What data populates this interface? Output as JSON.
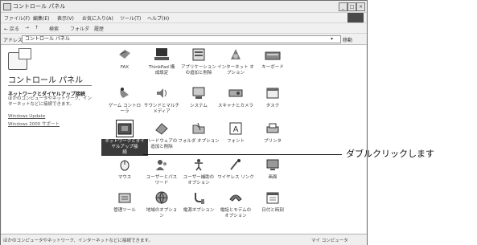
{
  "window": {
    "title": "コントロール パネル",
    "buttons": [
      "_",
      "□",
      "×"
    ]
  },
  "menubar": {
    "items": [
      "ファイル(F)",
      "編集(E)",
      "表示(V)",
      "お気に入り(A)",
      "ツール(T)",
      "ヘルプ(H)"
    ]
  },
  "toolbar": {
    "back": "← 戻る",
    "forward": "→",
    "up": "↑",
    "search": "検索",
    "folders": "フォルダ",
    "history": "履歴"
  },
  "address": {
    "label": "アドレス(D)",
    "value": "コントロール パネル",
    "go": "移動"
  },
  "left_pane": {
    "title": "コントロール パネル",
    "heading": "ネットワークとダイヤルアップ接続",
    "description": "ほかのコンピュータやネットワーク、インターネットなどに接続できます。",
    "links": [
      "Windows Update",
      "Windows 2000 サポート"
    ]
  },
  "icons": [
    {
      "name": "fax",
      "label": "FAX"
    },
    {
      "name": "thinkpad",
      "label": "ThinkPad 構\n成設定"
    },
    {
      "name": "add-remove-apps",
      "label": "アプリケーション\nの追加と削除"
    },
    {
      "name": "internet-options",
      "label": "インターネット オ\nプション"
    },
    {
      "name": "keyboard",
      "label": "キーボード"
    },
    {
      "name": "game-controller",
      "label": "ゲーム コントロ\nーラ"
    },
    {
      "name": "sounds-multimedia",
      "label": "サウンドとマルチ\nメディア"
    },
    {
      "name": "system",
      "label": "システム"
    },
    {
      "name": "scanners-cameras",
      "label": "スキャナとカメラ"
    },
    {
      "name": "tasks",
      "label": "タスク"
    },
    {
      "name": "network-dialup",
      "label": "ネットワークとダイ\nヤルアップ接\n続"
    },
    {
      "name": "add-remove-hardware",
      "label": "ハードウェアの\n追加と削除"
    },
    {
      "name": "folder-options",
      "label": "フォルダ オプション"
    },
    {
      "name": "fonts",
      "label": "フォント"
    },
    {
      "name": "printers",
      "label": "プリンタ"
    },
    {
      "name": "mouse",
      "label": "マウス"
    },
    {
      "name": "users-passwords",
      "label": "ユーザーとパス\nワード"
    },
    {
      "name": "accessibility",
      "label": "ユーザー補助の\nオプション"
    },
    {
      "name": "wireless-link",
      "label": "ワイヤレス リンク"
    },
    {
      "name": "display",
      "label": "画面"
    },
    {
      "name": "admin-tools",
      "label": "管理ツール"
    },
    {
      "name": "regional-options",
      "label": "地域のオプショ\nン"
    },
    {
      "name": "power-options",
      "label": "電源オプション"
    },
    {
      "name": "phone-modem",
      "label": "電話とモデムの\nオプション"
    },
    {
      "name": "date-time",
      "label": "日付と時刻"
    }
  ],
  "statusbar": {
    "left": "ほかのコンピュータやネットワーク、インターネットなどに接続できます。",
    "right": "マイ コンピュータ"
  },
  "callout": {
    "text": "ダブルクリックします"
  }
}
